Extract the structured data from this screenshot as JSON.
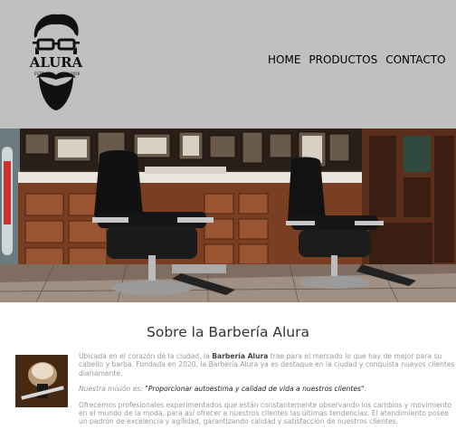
{
  "brand": {
    "name": "ALURA",
    "estd": "ESTD",
    "year": "2020"
  },
  "nav": {
    "items": [
      "HOME",
      "PRODUCTOS",
      "CONTACTO"
    ]
  },
  "about": {
    "title": "Sobre la Barbería Alura",
    "p1_a": "Ubicada en el corazón de la ciudad, la ",
    "p1_b": "Barbería Alura",
    "p1_c": " trae para el mercado lo que hay de mejor para su cabello y barba. Fundada en 2020, la Barbería Alura ya es destaque en la ciudad y conquista nuevos clientes diariamente.",
    "mission_label": "Nuestra misión es: ",
    "mission_quote": "\"Proporcionar autoestima y calidad de vida a nuestros clientes\"",
    "mission_end": ".",
    "p3": "Ofrecemos profesionales experimentados que están constantemente observando los cambios y movimiento en el mundo de la moda, para así ofrecer a nuestros clientes las últimas tendencias. El atendimiento posee un padrón de excelencia y agilidad, garantizando calidad y satisfacción de nuestros clientes."
  },
  "colors": {
    "header_bg": "#c0c0c0",
    "text_muted": "#9a9a9a"
  }
}
